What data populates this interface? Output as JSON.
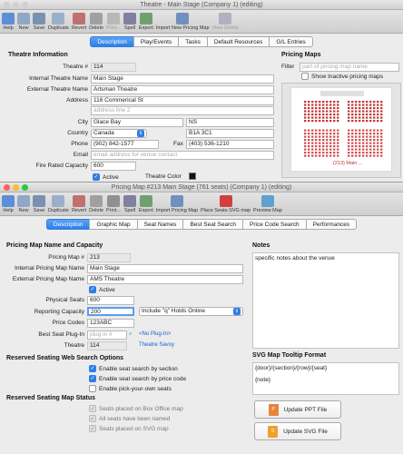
{
  "theatre_window": {
    "title": "Theatre - Main Stage (Company 1) (editing)",
    "toolbar": [
      {
        "label": "Help",
        "icon": "help-icon",
        "color": "#5b8fd8",
        "enabled": true
      },
      {
        "label": "New",
        "icon": "new-icon",
        "color": "#8fa8c8",
        "enabled": true
      },
      {
        "label": "Save",
        "icon": "save-icon",
        "color": "#7a90b0",
        "enabled": true
      },
      {
        "label": "Duplicate",
        "icon": "duplicate-icon",
        "color": "#9ab0c8",
        "enabled": true
      },
      {
        "label": "Revert",
        "icon": "revert-icon",
        "color": "#c07070",
        "enabled": true
      },
      {
        "label": "Delete",
        "icon": "delete-icon",
        "color": "#a0a0a0",
        "enabled": true
      },
      {
        "label": "Print...",
        "icon": "print-icon",
        "color": "#b8b8b8",
        "enabled": false
      },
      {
        "label": "Spell",
        "icon": "spell-icon",
        "color": "#8080a0",
        "enabled": true
      },
      {
        "label": "Export",
        "icon": "export-icon",
        "color": "#70a070",
        "enabled": true
      },
      {
        "label": "Import New Pricing Map",
        "icon": "import-icon",
        "color": "#7090c0",
        "enabled": true
      },
      {
        "label": "View Online",
        "icon": "view-online-icon",
        "color": "#b0b0c0",
        "enabled": false
      }
    ],
    "tabs": [
      "Description",
      "Play/Events",
      "Tasks",
      "Default Resources",
      "G/L Entries"
    ],
    "active_tab": "Description",
    "section_title": "Theatre Information",
    "theatre_number_label": "Theatre #",
    "theatre_number": "114",
    "internal_name_label": "Internal Theatre Name",
    "internal_name": "Main Stage",
    "external_name_label": "External Theatre Name",
    "external_name": "Artsman Theatre",
    "address_label": "Address",
    "address1": "116 Commerical St",
    "address2_placeholder": "address line 2",
    "city_label": "City",
    "city": "Glace Bay",
    "province": "NS",
    "country_label": "Country",
    "country": "Canada",
    "postal": "B1A 3C1",
    "phone_label": "Phone",
    "phone": "(902) 842-1577",
    "fax_label": "Fax",
    "fax": "(403) 536-1210",
    "email_label": "Email",
    "email_placeholder": "email address for venue contact",
    "fire_label": "Fire Rated Capacity",
    "fire_capacity": "600",
    "active_label": "Active",
    "theatre_color_label": "Theatre Color",
    "pricing_maps_title": "Pricing Maps",
    "filter_label": "Filter",
    "filter_placeholder": "part of pricing map name",
    "show_inactive_label": "Show Inactive pricing maps",
    "map_caption": "(213) Main ..."
  },
  "pricing_window": {
    "title": "Pricing Map #213 Main Stage (761 seats) (Company 1) (editing)",
    "toolbar": [
      {
        "label": "Help",
        "icon": "help-icon",
        "color": "#5b8fd8"
      },
      {
        "label": "New",
        "icon": "new-icon",
        "color": "#8fa8c8"
      },
      {
        "label": "Save",
        "icon": "save-icon",
        "color": "#7a90b0"
      },
      {
        "label": "Duplicate",
        "icon": "duplicate-icon",
        "color": "#9ab0c8"
      },
      {
        "label": "Revert",
        "icon": "revert-icon",
        "color": "#c07070"
      },
      {
        "label": "Delete",
        "icon": "delete-icon",
        "color": "#a0a0a0"
      },
      {
        "label": "Print...",
        "icon": "print-icon",
        "color": "#909090"
      },
      {
        "label": "Spell",
        "icon": "spell-icon",
        "color": "#8080a0"
      },
      {
        "label": "Export",
        "icon": "export-icon",
        "color": "#70a070"
      },
      {
        "label": "Import Pricing Map",
        "icon": "import-icon",
        "color": "#7090c0"
      },
      {
        "label": "Place Seats-SVG map",
        "icon": "place-seats-icon",
        "color": "#d04040"
      },
      {
        "label": "Preview Map",
        "icon": "preview-map-icon",
        "color": "#60a0d0"
      }
    ],
    "tabs": [
      "Description",
      "Graphic Map",
      "Seat Names",
      "Best Seat Search",
      "Price Code Search",
      "Performances"
    ],
    "active_tab": "Description",
    "section_title": "Pricing Map Name and Capacity",
    "pricing_number_label": "Pricing Map #",
    "pricing_number": "213",
    "internal_name_label": "Internal Pricing Map Name",
    "internal_name": "Main Stage",
    "external_name_label": "External Pricing Map Name",
    "external_name": "AMS Theatre",
    "active_label": "Active",
    "physical_label": "Physical Seats",
    "physical_seats": "600",
    "reporting_label": "Reporting Capacity",
    "reporting_capacity": "200",
    "include_option": "Include \"q\" Holds Online",
    "price_codes_label": "Price Codes",
    "price_codes": "123ABC",
    "plugin_label": "Best Seat Plug-In",
    "plugin_placeholder": "plug in #",
    "no_plugin": "<No Plug-In>",
    "theatre_label": "Theatre",
    "theatre_number": "114",
    "theatre_name": "Theatre Savoy",
    "notes_title": "Notes",
    "notes_text": "specific notes about the venue",
    "web_search_title": "Reserved Seating Web Search Options",
    "web_options": [
      {
        "label": "Enable seat search by section",
        "checked": true
      },
      {
        "label": "Enable seat search by price code",
        "checked": true
      },
      {
        "label": "Enable pick-your-own seats",
        "checked": false
      }
    ],
    "svg_title": "SVG Map Tooltip Format",
    "svg_line1": "{door}/{section}/{row}/{seat}",
    "svg_line2": "{note}",
    "status_title": "Reserved Seating Map Status",
    "status_items": [
      {
        "label": "Seats placed on Box Office map"
      },
      {
        "label": "All seats have been named"
      },
      {
        "label": "Seats placed on SVG map"
      }
    ],
    "update_ppt": "Update PPT File",
    "update_svg": "Update SVG File"
  }
}
